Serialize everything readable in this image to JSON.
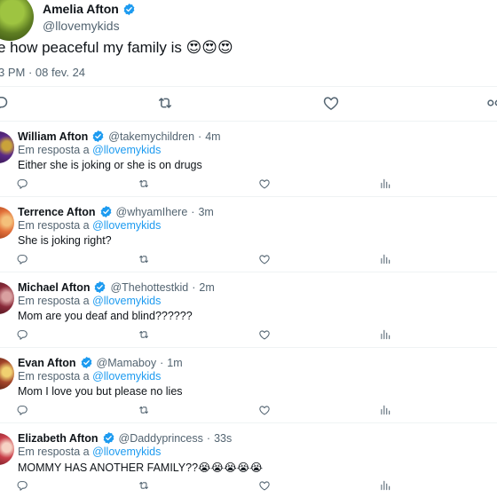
{
  "main_tweet": {
    "author_name": "Amelia Afton",
    "author_handle": "@llovemykids",
    "text": "e how peaceful my family is 😍😍😍",
    "meta": "3 PM · 08 fev. 24",
    "avatar_color": "#7a9a2e"
  },
  "replies": [
    {
      "name": "William Afton",
      "handle": "@takemychildren",
      "time": "4m",
      "in_reply_prefix": "Em resposta a",
      "in_reply_mention": "@llovemykids",
      "text": "Either she is joking or she is on drugs",
      "avatar_color": "#5b2a86"
    },
    {
      "name": "Terrence Afton",
      "handle": "@whyamIhere",
      "time": "3m",
      "in_reply_prefix": "Em resposta a",
      "in_reply_mention": "@llovemykids",
      "text": "She is joking right?",
      "avatar_color": "#e2703a"
    },
    {
      "name": "Michael Afton",
      "handle": "@Thehottestkid",
      "time": "2m",
      "in_reply_prefix": "Em resposta a",
      "in_reply_mention": "@llovemykids",
      "text": "Mom are you deaf and blind??????",
      "avatar_color": "#8a2b3a"
    },
    {
      "name": "Evan Afton",
      "handle": "@Mamaboy",
      "time": "1m",
      "in_reply_prefix": "Em resposta a",
      "in_reply_mention": "@llovemykids",
      "text": "Mom I love you but please no lies",
      "avatar_color": "#a3452a"
    },
    {
      "name": "Elizabeth Afton",
      "handle": "@Daddyprincess",
      "time": "33s",
      "in_reply_prefix": "Em resposta a",
      "in_reply_mention": "@llovemykids",
      "text": "MOMMY HAS ANOTHER FAMILY??😭😭😭😭😭",
      "avatar_color": "#c9404b"
    }
  ],
  "colors": {
    "verified": "#1d9bf0",
    "link": "#1d9bf0",
    "secondary_text": "#536471",
    "divider": "#eff3f4"
  },
  "icons": [
    "reply-icon",
    "retweet-icon",
    "like-icon",
    "analytics-icon",
    "share-icon",
    "verified-badge-icon"
  ]
}
